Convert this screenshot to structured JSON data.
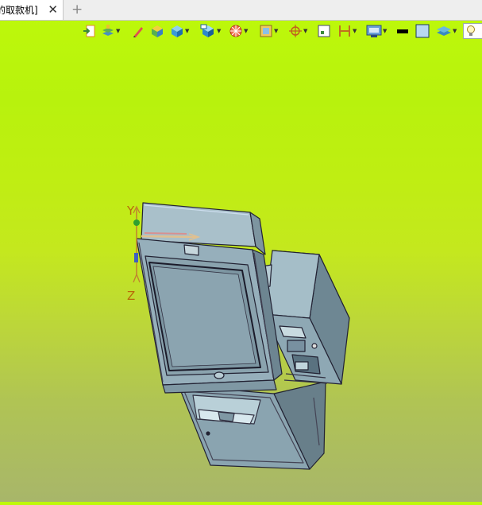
{
  "tab": {
    "title": "的取款机]",
    "close_glyph": "✕",
    "add_glyph": "+"
  },
  "toolbar": {
    "items": [
      "import-icon",
      "layers-icon",
      "pen-icon",
      "box-solid-icon",
      "cube-icon",
      "view-orient-icon",
      "render-mode-icon",
      "section-view-icon",
      "snap-point-icon",
      "measure-point-icon",
      "dimension-icon",
      "display-settings-icon",
      "line-color-icon",
      "fill-color-icon",
      "layer-stack-icon",
      "lightbulb-icon"
    ]
  },
  "viewport": {
    "axis_labels": {
      "y": "Y",
      "z": "Z"
    },
    "background_colors": {
      "top": "#bef90a",
      "bottom": "#a8b66a"
    },
    "model_color": "#7f9aa6"
  }
}
